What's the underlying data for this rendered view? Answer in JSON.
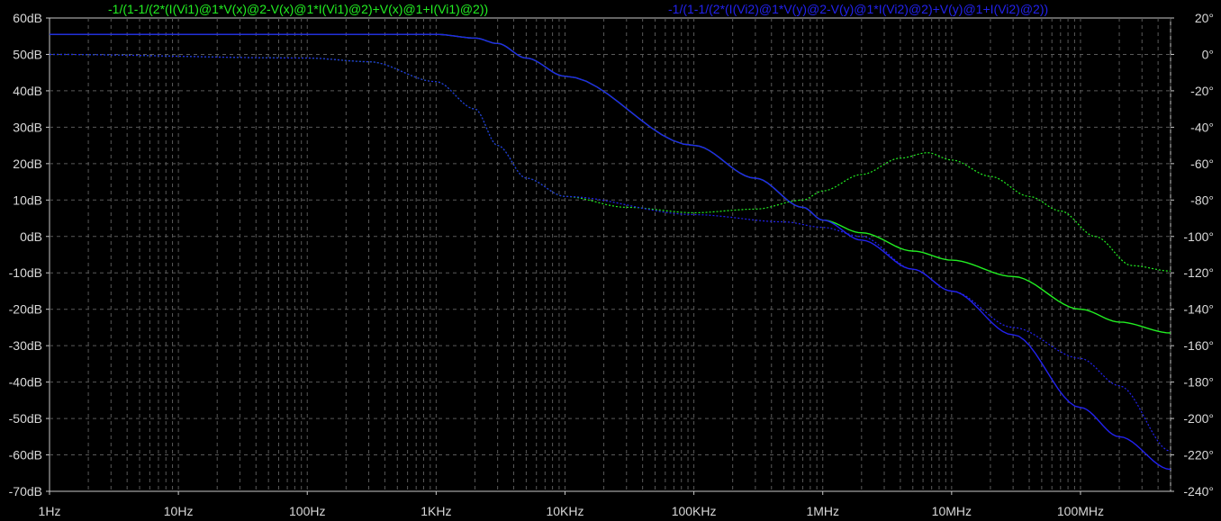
{
  "chart_data": {
    "type": "line",
    "x_scale": "log",
    "x_range_hz": [
      1,
      500000000
    ],
    "y_left_range_db": [
      -70,
      60
    ],
    "y_right_range_deg": [
      -240,
      20
    ],
    "grid": true,
    "x_tick_labels": [
      "1Hz",
      "10Hz",
      "100Hz",
      "1KHz",
      "10KHz",
      "100KHz",
      "1MHz",
      "10MHz",
      "100MHz"
    ],
    "x_tick_values": [
      1,
      10,
      100,
      1000,
      10000,
      100000,
      1000000,
      10000000,
      100000000
    ],
    "y_left_tick_labels": [
      "60dB",
      "50dB",
      "40dB",
      "30dB",
      "20dB",
      "10dB",
      "0dB",
      "-10dB",
      "-20dB",
      "-30dB",
      "-40dB",
      "-50dB",
      "-60dB",
      "-70dB"
    ],
    "y_left_tick_values": [
      60,
      50,
      40,
      30,
      20,
      10,
      0,
      -10,
      -20,
      -30,
      -40,
      -50,
      -60,
      -70
    ],
    "y_right_tick_labels": [
      "20°",
      "0°",
      "-20°",
      "-40°",
      "-60°",
      "-80°",
      "-100°",
      "-120°",
      "-140°",
      "-160°",
      "-180°",
      "-200°",
      "-220°",
      "-240°"
    ],
    "y_right_tick_values": [
      20,
      0,
      -20,
      -40,
      -60,
      -80,
      -100,
      -120,
      -140,
      -160,
      -180,
      -200,
      -220,
      -240
    ],
    "series": [
      {
        "name": "-1/(1-1/(2*(I(Vi1)@1*V(x)@2-V(x)@1*I(Vi1)@2)+V(x)@1+I(Vi1)@2))",
        "color": "#22ee22",
        "magnitude_db": [
          [
            1,
            55.5
          ],
          [
            10,
            55.5
          ],
          [
            100,
            55.5
          ],
          [
            1000,
            55.5
          ],
          [
            2000,
            54.5
          ],
          [
            3000,
            53
          ],
          [
            5000,
            49
          ],
          [
            10000,
            44
          ],
          [
            100000,
            25
          ],
          [
            300000,
            16
          ],
          [
            700000,
            8
          ],
          [
            1000000,
            4.5
          ],
          [
            2000000,
            1
          ],
          [
            5000000,
            -4
          ],
          [
            10000000,
            -6.5
          ],
          [
            30000000,
            -11
          ],
          [
            100000000,
            -20
          ],
          [
            200000000,
            -23.5
          ],
          [
            500000000,
            -26.5
          ]
        ],
        "phase_deg": [
          [
            1,
            0
          ],
          [
            100,
            -2
          ],
          [
            300,
            -4
          ],
          [
            1000,
            -15
          ],
          [
            2000,
            -30
          ],
          [
            3000,
            -50
          ],
          [
            5000,
            -68
          ],
          [
            10000,
            -78
          ],
          [
            30000,
            -84
          ],
          [
            100000,
            -87
          ],
          [
            300000,
            -85
          ],
          [
            700000,
            -80
          ],
          [
            1000000,
            -75
          ],
          [
            2000000,
            -66
          ],
          [
            4000000,
            -57
          ],
          [
            6500000,
            -54
          ],
          [
            10000000,
            -58
          ],
          [
            20000000,
            -67
          ],
          [
            40000000,
            -78
          ],
          [
            70000000,
            -86
          ],
          [
            130000000,
            -100
          ],
          [
            250000000,
            -116
          ],
          [
            500000000,
            -119
          ]
        ]
      },
      {
        "name": "-1/(1-1/(2*(I(Vi2)@1*V(y)@2-V(y)@1*I(Vi2)@2)+V(y)@1+I(Vi2)@2))",
        "color": "#2222ee",
        "magnitude_db": [
          [
            1,
            55.5
          ],
          [
            10,
            55.5
          ],
          [
            100,
            55.5
          ],
          [
            1000,
            55.5
          ],
          [
            2000,
            54.5
          ],
          [
            3000,
            53
          ],
          [
            5000,
            49
          ],
          [
            10000,
            44
          ],
          [
            100000,
            25
          ],
          [
            300000,
            16
          ],
          [
            700000,
            8
          ],
          [
            1000000,
            4.5
          ],
          [
            2000000,
            -1
          ],
          [
            5000000,
            -9
          ],
          [
            10000000,
            -15
          ],
          [
            30000000,
            -27
          ],
          [
            100000000,
            -47
          ],
          [
            200000000,
            -55
          ],
          [
            500000000,
            -64
          ]
        ],
        "phase_deg": [
          [
            1,
            0
          ],
          [
            100,
            -2
          ],
          [
            300,
            -4
          ],
          [
            1000,
            -15
          ],
          [
            2000,
            -30
          ],
          [
            3000,
            -50
          ],
          [
            5000,
            -68
          ],
          [
            10000,
            -78
          ],
          [
            100000,
            -88
          ],
          [
            500000,
            -92
          ],
          [
            1000000,
            -95
          ],
          [
            2000000,
            -100
          ],
          [
            5000000,
            -118
          ],
          [
            10000000,
            -130
          ],
          [
            30000000,
            -150
          ],
          [
            100000000,
            -167
          ],
          [
            200000000,
            -182
          ],
          [
            500000000,
            -218
          ]
        ]
      }
    ]
  },
  "colors": {
    "background": "#000000",
    "grid": "#5a5a5a",
    "axis": "#c8c8c8",
    "tick_text": "#d8d8d8"
  }
}
